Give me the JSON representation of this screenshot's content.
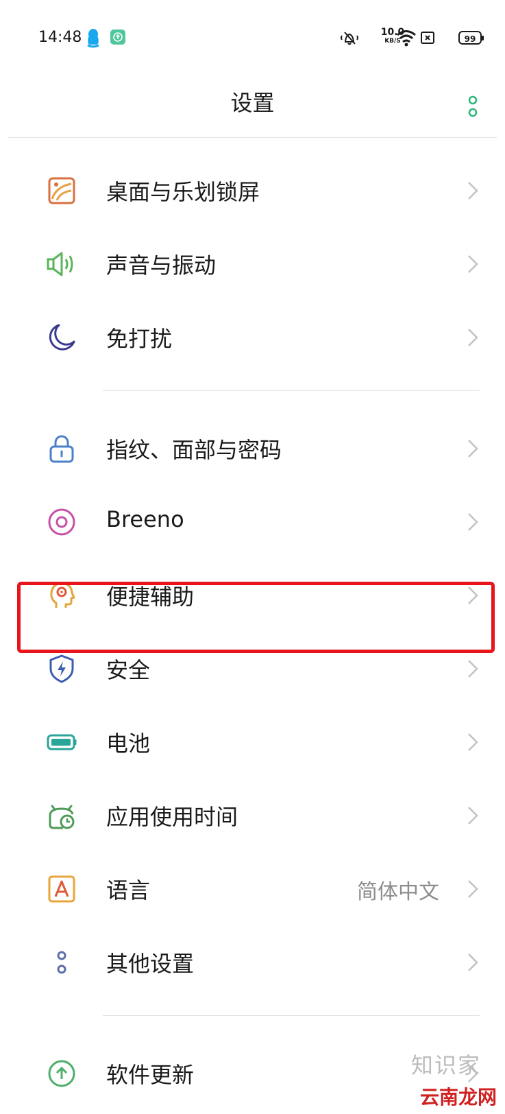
{
  "status_bar": {
    "time": "14:48",
    "net_speed_value": "10.0",
    "net_speed_unit": "KB/S",
    "battery": "99"
  },
  "header": {
    "title": "设置"
  },
  "items": [
    {
      "label": "桌面与乐划锁屏",
      "icon": "wallpaper-icon",
      "color": "#d9703f"
    },
    {
      "label": "声音与振动",
      "icon": "speaker-icon",
      "color": "#5bb35a"
    },
    {
      "label": "免打扰",
      "icon": "moon-icon",
      "color": "#3b3a8f"
    },
    {
      "label": "指纹、面部与密码",
      "icon": "lock-icon",
      "color": "#4a7fc9"
    },
    {
      "label": "Breeno",
      "icon": "breeno-icon",
      "color": "#c84fa8"
    },
    {
      "label": "便捷辅助",
      "icon": "assist-head-icon",
      "color": "#e2a53a"
    },
    {
      "label": "安全",
      "icon": "shield-icon",
      "color": "#3d5eb0"
    },
    {
      "label": "电池",
      "icon": "battery-icon",
      "color": "#2aa59a"
    },
    {
      "label": "应用使用时间",
      "icon": "app-timer-icon",
      "color": "#4e9a57"
    },
    {
      "label": "语言",
      "value": "简体中文",
      "icon": "language-icon",
      "color": "#e8a53b"
    },
    {
      "label": "其他设置",
      "icon": "more-settings-icon",
      "color": "#5d6fa8"
    },
    {
      "label": "软件更新",
      "icon": "update-icon",
      "color": "#4caf6a"
    }
  ],
  "watermark": {
    "text": "云南龙网",
    "subtext": "知识家"
  },
  "accent_color": "#2fb87d",
  "highlight_color": "#e8141b"
}
